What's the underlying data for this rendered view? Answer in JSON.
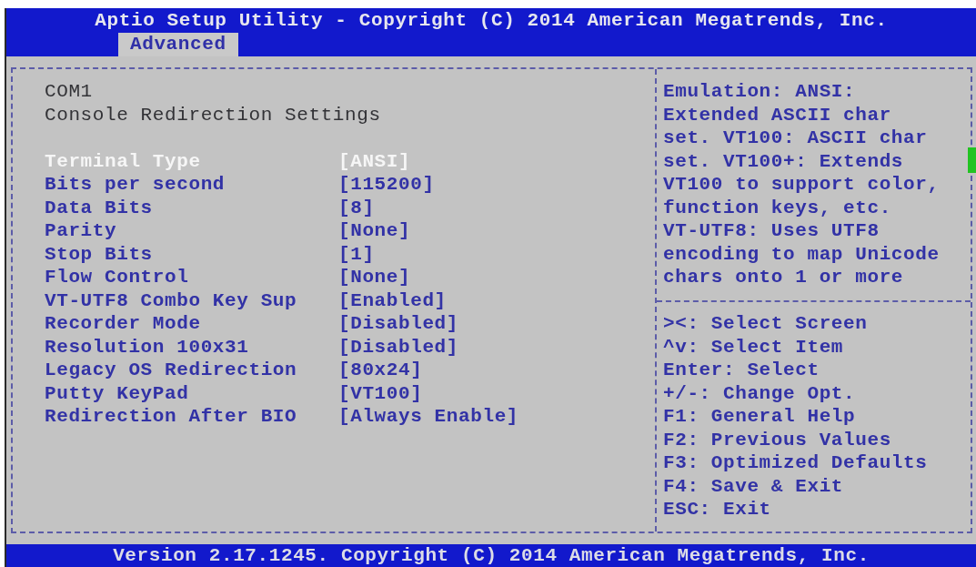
{
  "window": {
    "title": "Aptio Setup Utility - Copyright (C) 2014 American Megatrends, Inc."
  },
  "tabs": [
    {
      "label": "Advanced",
      "selected": true
    }
  ],
  "settings_panel": {
    "title": "COM1",
    "subtitle": "Console Redirection Settings",
    "items": [
      {
        "label": "Terminal Type",
        "value": "[ANSI]",
        "selected": true
      },
      {
        "label": "Bits per second",
        "value": "[115200]",
        "selected": false
      },
      {
        "label": "Data Bits",
        "value": "[8]",
        "selected": false
      },
      {
        "label": "Parity",
        "value": "[None]",
        "selected": false
      },
      {
        "label": "Stop Bits",
        "value": "[1]",
        "selected": false
      },
      {
        "label": "Flow Control",
        "value": "[None]",
        "selected": false
      },
      {
        "label": "VT-UTF8 Combo Key Sup",
        "value": "[Enabled]",
        "selected": false
      },
      {
        "label": "Recorder Mode",
        "value": "[Disabled]",
        "selected": false
      },
      {
        "label": "Resolution 100x31",
        "value": "[Disabled]",
        "selected": false
      },
      {
        "label": "Legacy OS Redirection",
        "value": "[80x24]",
        "selected": false
      },
      {
        "label": "Putty KeyPad",
        "value": "[VT100]",
        "selected": false
      },
      {
        "label": "Redirection After BIO",
        "value": "[Always Enable]",
        "selected": false
      }
    ]
  },
  "help_panel": {
    "description": "Emulation: ANSI:\nExtended ASCII char\nset. VT100: ASCII char\nset. VT100+: Extends\nVT100 to support color,\nfunction keys, etc.\nVT-UTF8: Uses UTF8\nencoding to map Unicode\nchars onto 1 or more",
    "key_hints": [
      "><: Select Screen",
      "^v: Select Item",
      "Enter: Select",
      "+/-: Change Opt.",
      "F1: General Help",
      "F2: Previous Values",
      "F3: Optimized Defaults",
      "F4: Save & Exit",
      "ESC: Exit"
    ]
  },
  "status_bar": {
    "text": "Version 2.17.1245. Copyright (C) 2014 American Megatrends, Inc."
  }
}
